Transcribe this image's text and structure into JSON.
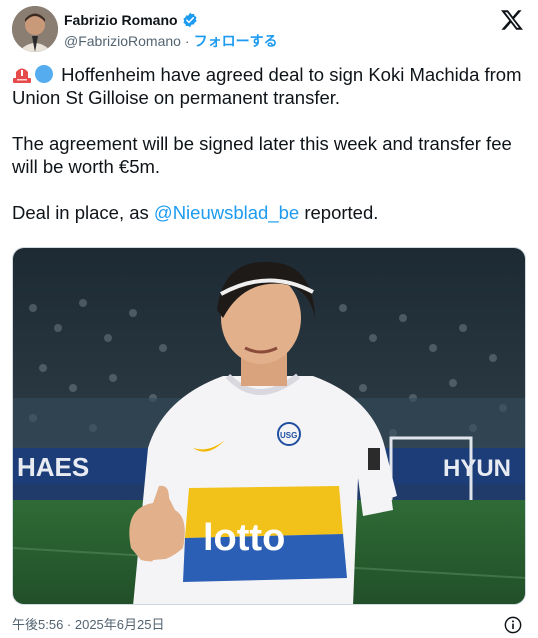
{
  "author": {
    "name": "Fabrizio Romano",
    "handle": "@FabrizioRomano",
    "separator": "·",
    "follow_label": "フォローする"
  },
  "tweet": {
    "emojis": [
      "rotating-light-icon",
      "blue-circle-icon"
    ],
    "line1": "Hoffenheim have agreed deal to sign Koki Machida from Union St Gilloise on permanent transfer.",
    "line2": "The agreement will be signed later this week and transfer fee will be worth €5m.",
    "line3_before": "Deal in place, as ",
    "mention": "@Nieuwsblad_be",
    "line3_after": " reported."
  },
  "media": {
    "jersey_sponsor": "lotto",
    "badge": "USG",
    "board_left": "HAES",
    "board_right": "HYUN"
  },
  "footer": {
    "timestamp": "午後5:56 · 2025年6月25日"
  },
  "colors": {
    "accent": "#1d9bf0",
    "text": "#0f1419",
    "muted": "#536471"
  }
}
